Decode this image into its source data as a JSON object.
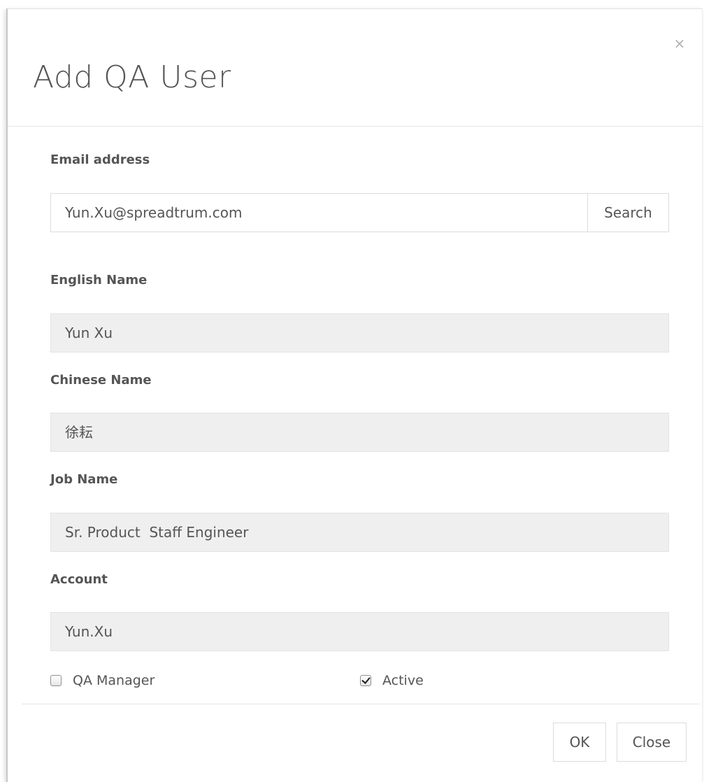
{
  "dialog": {
    "title": "Add QA User",
    "close_icon": "×"
  },
  "form": {
    "email": {
      "label": "Email address",
      "value": "Yun.Xu@spreadtrum.com",
      "search_label": "Search"
    },
    "english_name": {
      "label": "English Name",
      "value": "Yun Xu"
    },
    "chinese_name": {
      "label": "Chinese Name",
      "value": "徐耘"
    },
    "job_name": {
      "label": "Job Name",
      "value": "Sr. Product  Staff Engineer"
    },
    "account": {
      "label": "Account",
      "value": "Yun.Xu"
    },
    "qa_manager": {
      "label": "QA Manager",
      "checked": false
    },
    "active": {
      "label": "Active",
      "checked": true
    }
  },
  "footer": {
    "ok_label": "OK",
    "close_label": "Close"
  }
}
